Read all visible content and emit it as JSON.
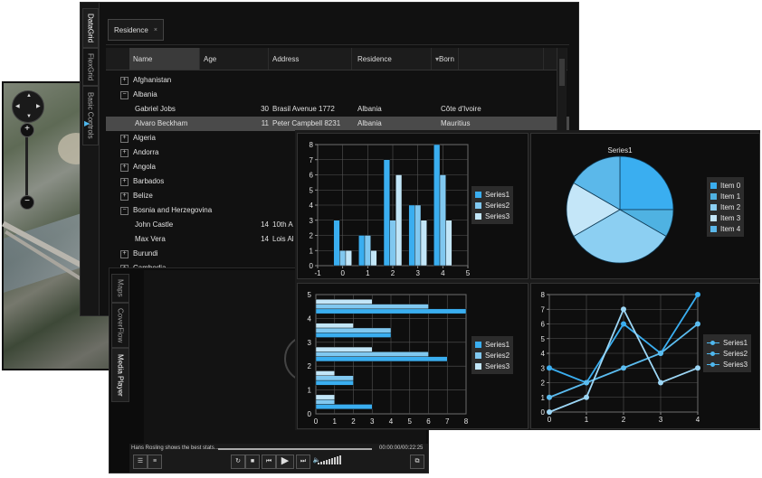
{
  "datagrid": {
    "tabs": [
      "DataGrid",
      "FlexGrid",
      "Basic Controls"
    ],
    "group_chip": "Residence",
    "columns": [
      "Name",
      "Age",
      "Address",
      "Residence",
      "Born"
    ],
    "rows": [
      {
        "type": "group",
        "label": "Afghanistan",
        "expanded": false
      },
      {
        "type": "group",
        "label": "Albania",
        "expanded": true
      },
      {
        "type": "item",
        "name": "Gabriel Jobs",
        "age": "30",
        "address": "Brasil Avenue 1772",
        "residence": "Albania",
        "born": "Côte d'Ivoire"
      },
      {
        "type": "item",
        "name": "Alvaro Beckham",
        "age": "11",
        "address": "Peter Campbell 8231",
        "residence": "Albania",
        "born": "Mauritius",
        "selected": true
      },
      {
        "type": "group",
        "label": "Algeria",
        "expanded": false
      },
      {
        "type": "group",
        "label": "Andorra",
        "expanded": false
      },
      {
        "type": "group",
        "label": "Angola",
        "expanded": false
      },
      {
        "type": "group",
        "label": "Barbados",
        "expanded": false
      },
      {
        "type": "group",
        "label": "Belize",
        "expanded": false
      },
      {
        "type": "group",
        "label": "Bosnia and Herzegovina",
        "expanded": true
      },
      {
        "type": "item",
        "name": "John Castle",
        "age": "14",
        "address": "10th A",
        "residence": "",
        "born": ""
      },
      {
        "type": "item",
        "name": "Max Vera",
        "age": "14",
        "address": "Lois Al",
        "residence": "",
        "born": ""
      },
      {
        "type": "group",
        "label": "Burundi",
        "expanded": false
      },
      {
        "type": "group",
        "label": "Cambodia",
        "expanded": false
      }
    ]
  },
  "media": {
    "tabs": [
      "Maps",
      "CoverFlow",
      "Media Player"
    ],
    "now_playing": "Hans Rosling shows the best stats...",
    "time": "00:00:00/00:22:25",
    "controls": [
      "menu-icon",
      "playlist-icon",
      "replay-icon",
      "stop-icon",
      "prev-icon",
      "play-icon",
      "next-icon",
      "volume-icon",
      "fullscreen-icon"
    ]
  },
  "map": {
    "controls": [
      "pan-icon",
      "zoom-in-icon",
      "zoom-out-icon"
    ]
  },
  "colors": {
    "s1": "#3aaef0",
    "s2": "#80c8f0",
    "s3": "#c2e6f8",
    "accent": "#4fb8ef"
  },
  "chart_data": [
    {
      "type": "bar",
      "x": [
        0,
        1,
        2,
        3,
        4
      ],
      "series": [
        {
          "name": "Series1",
          "values": [
            3,
            2,
            7,
            4,
            8
          ]
        },
        {
          "name": "Series2",
          "values": [
            1,
            2,
            3,
            4,
            6
          ]
        },
        {
          "name": "Series3",
          "values": [
            1,
            1,
            6,
            3,
            3
          ]
        }
      ],
      "xlim": [
        -1,
        5
      ],
      "ylim": [
        0,
        8
      ],
      "xticks": [
        "-1",
        "0",
        "1",
        "2",
        "3",
        "4",
        "5"
      ],
      "yticks": [
        "0",
        "1",
        "2",
        "3",
        "4",
        "5",
        "6",
        "7",
        "8"
      ],
      "legend": "right"
    },
    {
      "type": "pie",
      "title": "Series1",
      "labels": [
        "Item 0",
        "Item 1",
        "Item 2",
        "Item 3",
        "Item 4"
      ],
      "values": [
        3,
        1,
        4,
        2,
        2
      ],
      "legend": "right"
    },
    {
      "type": "bar",
      "orientation": "horizontal",
      "categories": [
        0,
        1,
        2,
        3,
        4
      ],
      "series": [
        {
          "name": "Series1",
          "values": [
            3,
            2,
            7,
            4,
            8
          ]
        },
        {
          "name": "Series2",
          "values": [
            1,
            2,
            6,
            4,
            6
          ]
        },
        {
          "name": "Series3",
          "values": [
            1,
            1,
            3,
            2,
            3
          ]
        }
      ],
      "xlim": [
        0,
        8
      ],
      "ylim": [
        0,
        5
      ],
      "xticks": [
        "0",
        "1",
        "2",
        "3",
        "4",
        "5",
        "6",
        "7",
        "8"
      ],
      "yticks": [
        "0",
        "1",
        "2",
        "3",
        "4",
        "5"
      ],
      "legend": "right"
    },
    {
      "type": "line",
      "x": [
        0,
        1,
        2,
        3,
        4
      ],
      "series": [
        {
          "name": "Series1",
          "values": [
            3,
            2,
            6,
            4,
            8
          ]
        },
        {
          "name": "Series2",
          "values": [
            1,
            2,
            3,
            4,
            6
          ]
        },
        {
          "name": "Series3",
          "values": [
            0,
            1,
            7,
            2,
            3
          ]
        }
      ],
      "xlim": [
        0,
        4
      ],
      "ylim": [
        0,
        8
      ],
      "xticks": [
        "0",
        "1",
        "2",
        "3",
        "4"
      ],
      "yticks": [
        "0",
        "1",
        "2",
        "3",
        "4",
        "5",
        "6",
        "7",
        "8"
      ],
      "legend": "right"
    }
  ]
}
